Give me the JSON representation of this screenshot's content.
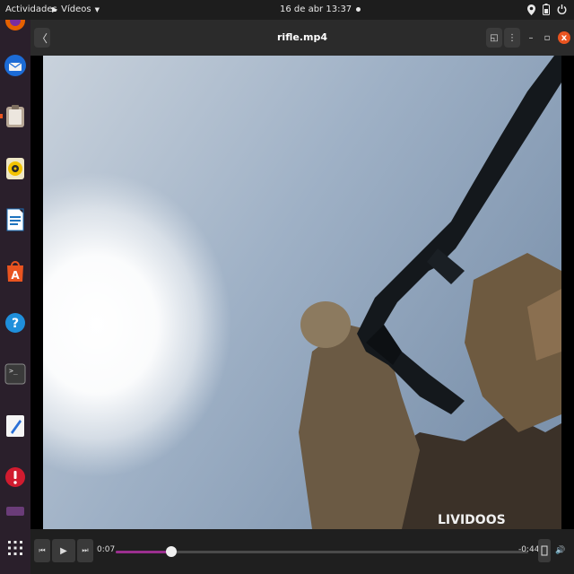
{
  "topbar": {
    "activities": "Actividades",
    "app_menu": "Vídeos",
    "clock": "16 de abr  13:37"
  },
  "window": {
    "title": "rifle.mp4",
    "back_glyph": "〈",
    "subtitles_glyph": "◱",
    "menu_glyph": "⋮",
    "minimize_glyph": "–",
    "maximize_glyph": "▫",
    "close_glyph": "x"
  },
  "video": {
    "watermark": "LIVIDOOS"
  },
  "player": {
    "elapsed": "0:07",
    "remaining": "-0:44",
    "progress": 0.135,
    "prev_glyph": "⏮",
    "play_glyph": "▶",
    "next_glyph": "⏭",
    "volume_glyph": "🔊"
  },
  "dock": {
    "items": [
      "firefox-icon",
      "thunderbird-icon",
      "files-icon",
      "rhythmbox-icon",
      "writer-icon",
      "software-icon",
      "help-icon",
      "terminal-icon",
      "text-editor-icon",
      "error-report-icon",
      "trash-icon",
      "app-grid-icon"
    ]
  },
  "colors": {
    "accent": "#e95420",
    "progress": "#9b2f8f",
    "dock_bg": "#2a1f2b"
  }
}
